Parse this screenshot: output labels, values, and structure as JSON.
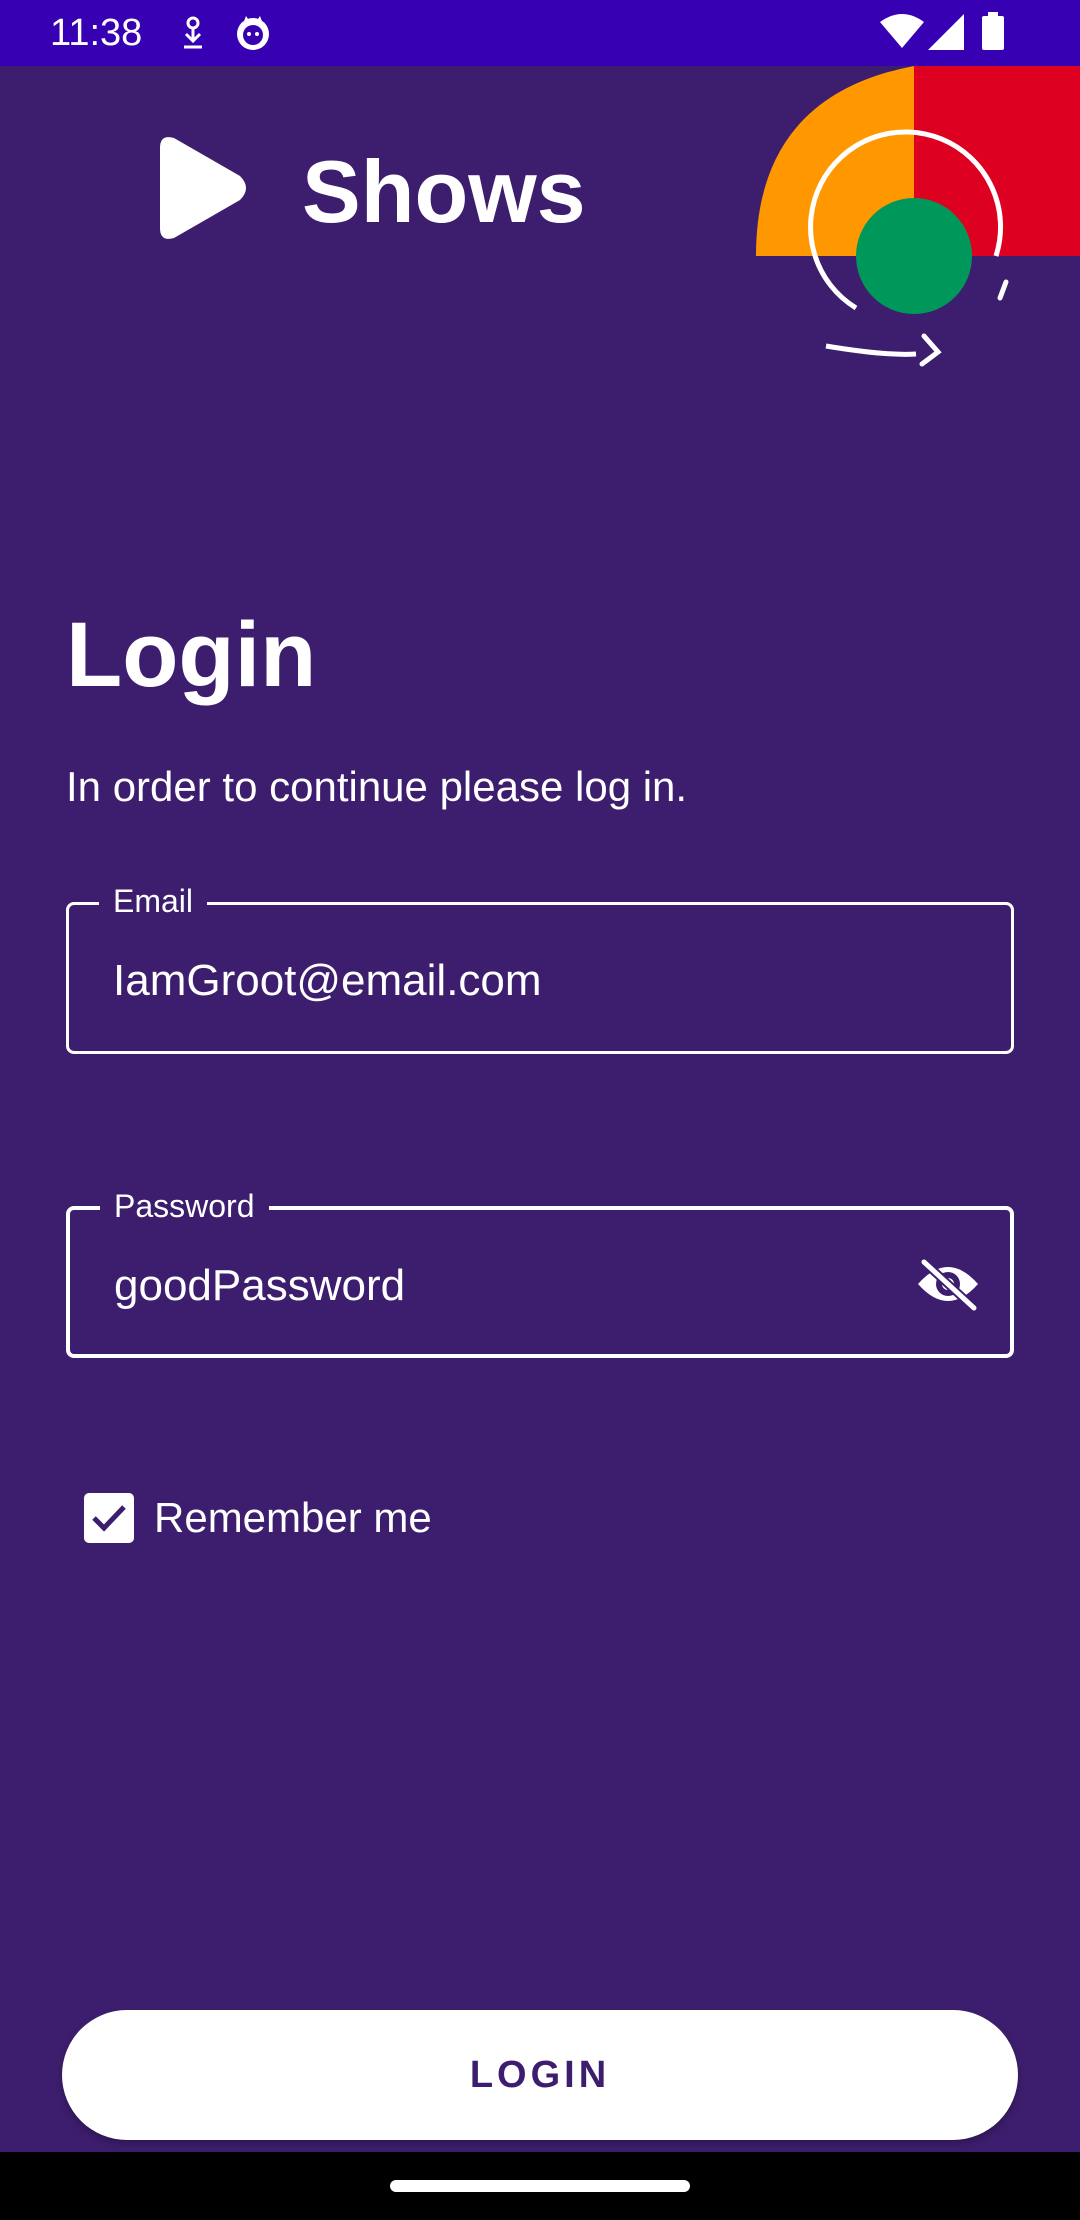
{
  "status_bar": {
    "time": "11:38",
    "icons": [
      "download-icon",
      "cat-notification-icon",
      "wifi-icon",
      "cellular-signal-icon",
      "battery-icon"
    ],
    "background": "#3700B3"
  },
  "header": {
    "app_title": "Shows",
    "logo_icon": "play-logo-icon"
  },
  "login": {
    "heading": "Login",
    "subtitle": "In order to continue please log in.",
    "email": {
      "label": "Email",
      "value": "IamGroot@email.com"
    },
    "password": {
      "label": "Password",
      "value": "goodPassword",
      "toggle_icon": "visibility-off-icon"
    },
    "remember_me": {
      "label": "Remember me",
      "checked": true
    },
    "button_label": "LOGIN"
  },
  "colors": {
    "background": "#3D1E6E",
    "accent_orange": "#FF9800",
    "accent_red": "#DD0020",
    "accent_green": "#00985A",
    "button_text": "#3D1E6E"
  }
}
